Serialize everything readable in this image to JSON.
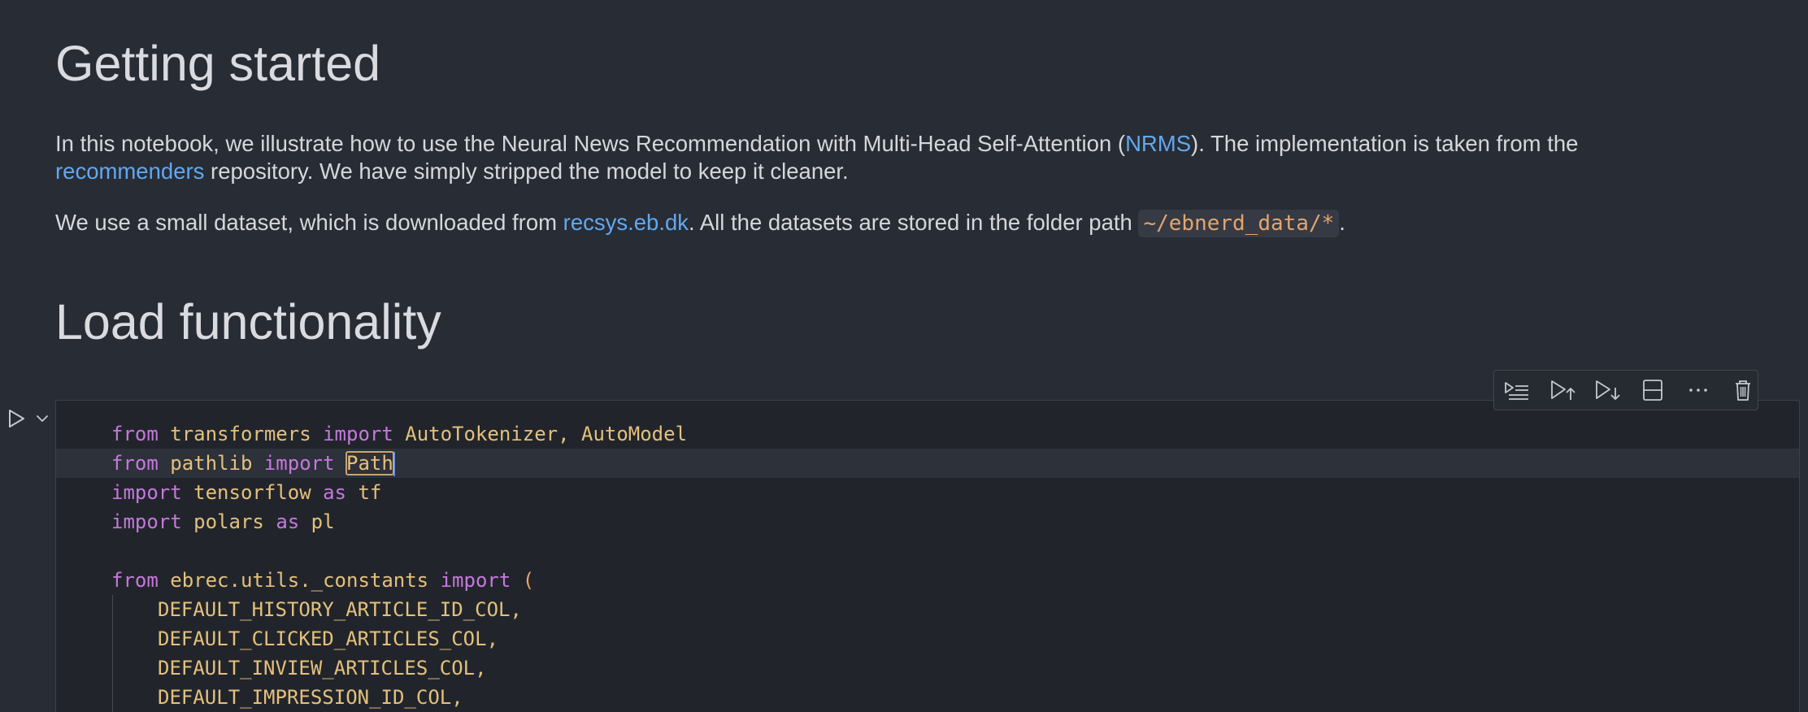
{
  "markdown": {
    "heading_getting_started": "Getting started",
    "intro": {
      "part1": "In this notebook, we illustrate how to use the Neural News Recommendation with Multi-Head Self-Attention (",
      "nrms_link": "NRMS",
      "part2": "). The implementation is taken from the",
      "recommenders_link": "recommenders",
      "part3": " repository. We have simply stripped the model to keep it cleaner."
    },
    "dataset": {
      "part1": "We use a small dataset, which is downloaded from ",
      "link": "recsys.eb.dk",
      "part2": ". All the datasets are stored in the folder path ",
      "code": "~/ebnerd_data/*",
      "part3": "."
    },
    "heading_load": "Load functionality"
  },
  "cell_toolbar": {
    "icons": [
      "run-by-line-icon",
      "execute-above-icon",
      "execute-below-icon",
      "split-cell-icon",
      "more-actions-icon",
      "delete-cell-icon"
    ]
  },
  "code": {
    "line1": {
      "kw1": "from",
      "mod": "transformers",
      "kw2": "import",
      "names": "AutoTokenizer, AutoModel"
    },
    "line2": {
      "kw1": "from",
      "mod": "pathlib",
      "kw2": "import",
      "name": "Path"
    },
    "line3": {
      "kw1": "import",
      "mod": "tensorflow",
      "kw2": "as",
      "alias": "tf"
    },
    "line4": {
      "kw1": "import",
      "mod": "polars",
      "kw2": "as",
      "alias": "pl"
    },
    "line6": {
      "kw1": "from",
      "mod": "ebrec.utils._constants",
      "kw2": "import",
      "paren": "("
    },
    "constants": [
      "DEFAULT_HISTORY_ARTICLE_ID_COL,",
      "DEFAULT_CLICKED_ARTICLES_COL,",
      "DEFAULT_INVIEW_ARTICLES_COL,",
      "DEFAULT_IMPRESSION_ID_COL,"
    ]
  },
  "colors": {
    "background": "#282c34",
    "cell_background": "#21252b",
    "keyword": "#c678dd",
    "identifier": "#e5c07b",
    "link": "#61a8f0",
    "inline_code": "#e5a56b"
  }
}
